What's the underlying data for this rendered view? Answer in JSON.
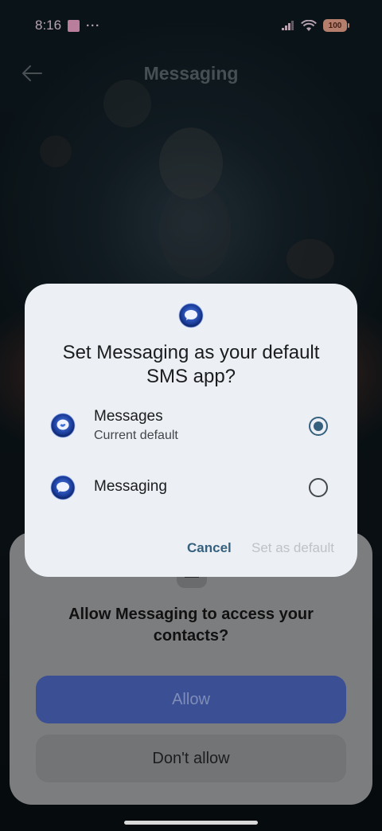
{
  "status_bar": {
    "time": "8:16",
    "more": "···",
    "battery": "100"
  },
  "app_header": {
    "title": "Messaging"
  },
  "dialog": {
    "title": "Set Messaging as your default SMS app?",
    "options": [
      {
        "label": "Messages",
        "sublabel": "Current default",
        "selected": true
      },
      {
        "label": "Messaging",
        "sublabel": "",
        "selected": false
      }
    ],
    "cancel_label": "Cancel",
    "set_default_label": "Set as default"
  },
  "permission_sheet": {
    "title": "Allow Messaging to access your contacts?",
    "allow_label": "Allow",
    "deny_label": "Don't allow"
  },
  "colors": {
    "accent": "#35617f",
    "dialog_bg": "#eceff3",
    "allow_button": "#3a4f94"
  },
  "icons": {
    "back": "back-arrow-icon",
    "app": "chat-bubble-icon",
    "signal": "signal-icon",
    "wifi": "wifi-icon",
    "battery": "battery-icon"
  }
}
